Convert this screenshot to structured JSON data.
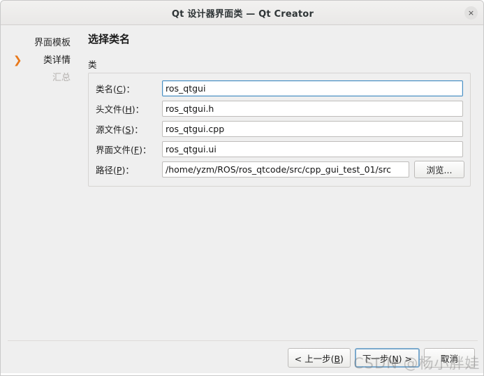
{
  "window": {
    "title": "Qt 设计器界面类 — Qt Creator",
    "close_icon": "×"
  },
  "sidebar": {
    "items": [
      {
        "label": "界面模板",
        "state": "done"
      },
      {
        "label": "类详情",
        "state": "current",
        "arrow": "❯"
      },
      {
        "label": "汇总",
        "state": "disabled"
      }
    ]
  },
  "main": {
    "page_title": "选择类名",
    "group_label": "类",
    "fields": [
      {
        "label_prefix": "类名(",
        "label_key": "C",
        "label_suffix": ")：",
        "value": "ros_qtgui",
        "name": "class-name"
      },
      {
        "label_prefix": "头文件(",
        "label_key": "H",
        "label_suffix": ")：",
        "value": "ros_qtgui.h",
        "name": "header-file"
      },
      {
        "label_prefix": "源文件(",
        "label_key": "S",
        "label_suffix": ")：",
        "value": "ros_qtgui.cpp",
        "name": "source-file"
      },
      {
        "label_prefix": "界面文件(",
        "label_key": "F",
        "label_suffix": ")：",
        "value": "ros_qtgui.ui",
        "name": "form-file"
      }
    ],
    "path_field": {
      "label_prefix": "路径(",
      "label_key": "P",
      "label_suffix": ")：",
      "value": "/home/yzm/ROS/ros_qtcode/src/cpp_gui_test_01/src",
      "browse_label": "浏览..."
    }
  },
  "footer": {
    "back_prefix": "< 上一步(",
    "back_key": "B",
    "back_suffix": ")",
    "next_prefix": "下一步(",
    "next_key": "N",
    "next_suffix": ") >",
    "cancel_label": "取消"
  },
  "watermark": {
    "text": "CSDN @杨小胖娃"
  },
  "colors": {
    "accent_orange": "#e8781a",
    "focus_blue": "#4a90c4",
    "window_bg": "#efefef",
    "input_bg": "#ffffff"
  }
}
